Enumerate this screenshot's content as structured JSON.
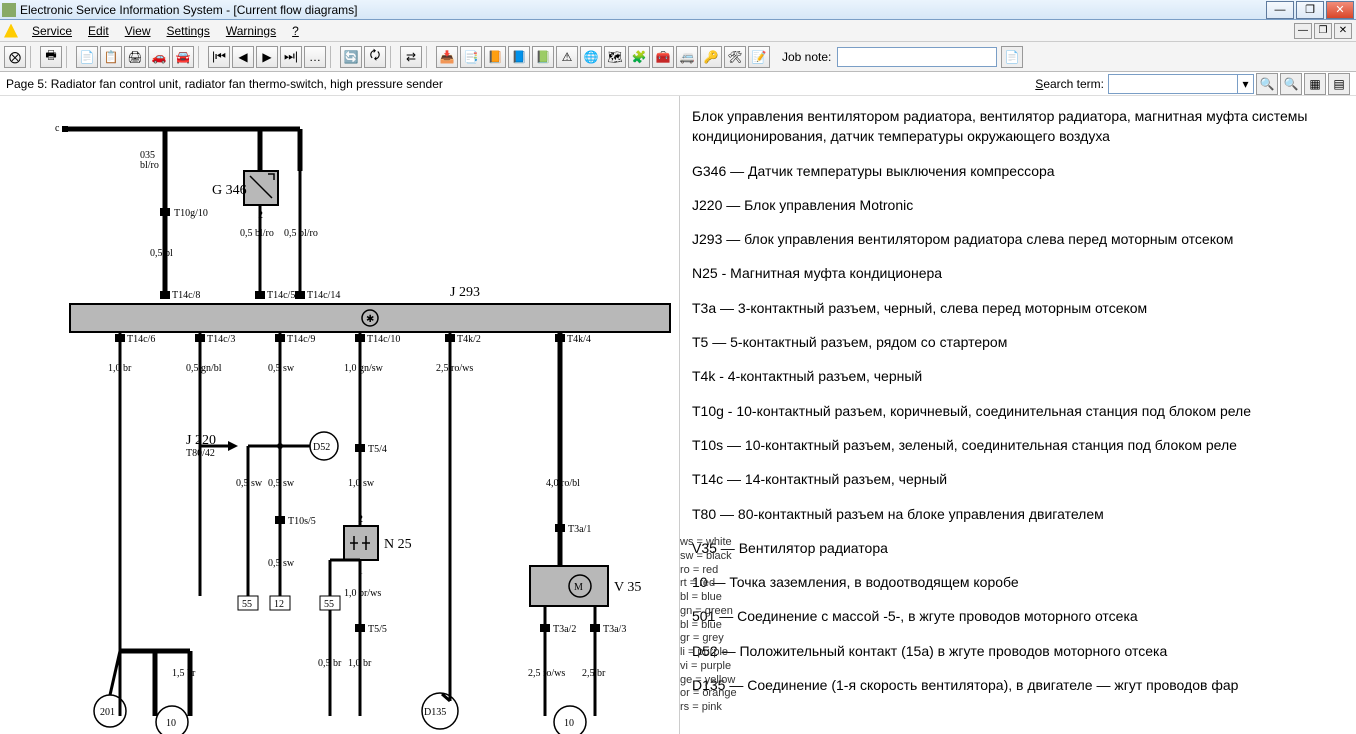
{
  "window": {
    "title": "Electronic Service Information System - [Current flow diagrams]",
    "minimize": "—",
    "maximize": "❐",
    "close": "✕"
  },
  "menu": {
    "items": [
      "Service",
      "Edit",
      "View",
      "Settings",
      "Warnings",
      "?"
    ]
  },
  "toolbar": {
    "icons": [
      "⨂",
      "🖶",
      "📄",
      "📋",
      "🖨",
      "🚗",
      "🚘",
      "|⏮",
      "◀",
      "▶",
      "⏭|",
      "…",
      "🔄",
      "🗘",
      "⇄",
      "📥",
      "📑",
      "📙",
      "📘",
      "📗",
      "⚠",
      "🌐",
      "🗺",
      "🧩",
      "🧰",
      "🚐",
      "🔑",
      "🛠",
      "📝"
    ],
    "jobnote_label": "Job note:",
    "jobnote_value": "",
    "jobnote_btn": "📄"
  },
  "subheader": {
    "title": "Page 5: Radiator fan control unit, radiator fan thermo-switch, high pressure sender",
    "search_label": "Search term:",
    "search_value": ""
  },
  "diagram": {
    "labels": {
      "c": "c",
      "G346": "G 346",
      "J293": "J 293",
      "J220": "J 220",
      "N25": "N 25",
      "V35": "V 35",
      "D52": "D52",
      "D135": "D135",
      "n201": "201",
      "n10a": "10",
      "n10b": "10",
      "n55a": "55",
      "n55b": "55",
      "n12": "12",
      "T10g10": "T10g/10",
      "T14c8": "T14c/8",
      "T14c5": "T14c/5",
      "T14c14": "T14c/14",
      "T14c6": "T14c/6",
      "T14c3": "T14c/3",
      "T14c9": "T14c/9",
      "T14c10": "T14c/10",
      "T4k2": "T4k/2",
      "T4k4": "T4k/4",
      "T80_42": "T80/42",
      "T5_4": "T5/4",
      "T10s5": "T10s/5",
      "T5_5": "T5/5",
      "T3a1": "T3a/1",
      "T3a2": "T3a/2",
      "T3a3": "T3a/3",
      "w035": "035",
      "w_blro": "bl/ro",
      "w05bl": "0,5\nbl",
      "w05blro": "0,5\nbl/ro",
      "w05blro2": "0,5\nbl/ro",
      "w10br": "1,0\nbr",
      "w05gnbl": "0,5\ngn/bl",
      "w05sw": "0,5\nsw",
      "w10gnsw": "1,0\ngn/sw",
      "w25rows": "2,5\nro/ws",
      "w05sw2": "0,5\nsw",
      "w05sw3": "0,5\nsw",
      "w10sw": "1,0\nsw",
      "w40robl": "4,0\nro/bl",
      "w05sw4": "0,5\nsw",
      "w10brws": "1,0\nbr/ws",
      "w05br": "0,5\nbr",
      "w10br2": "1,0\nbr",
      "w15br": "1,5\nbr",
      "w25rows2": "2,5\nro/ws",
      "w25br": "2,5\nbr",
      "pin1": "1",
      "pin2": "2"
    }
  },
  "descriptions": [
    "Блок управления вентилятором радиатора, вентилятор радиатора, магнитная муфта системы кондиционирования, датчик температуры окружающего воздуха",
    "G346 — Датчик температуры выключения компрессора",
    "J220 — Блок управления Motronic",
    "J293 — блок управления вентилятором радиатора слева перед моторным отсеком",
    "N25 - Магнитная муфта кондиционера",
    "T3a — 3-контактный разъем, черный, слева перед моторным отсеком",
    "T5 — 5-контактный разъем, рядом со стартером",
    "T4k - 4-контактный разъем, черный",
    "T10g - 10-контактный разъем, коричневый, соединительная станция под блоком реле",
    "T10s — 10-контактный разъем, зеленый, соединительная станция под блоком реле",
    "T14c — 14-контактный разъем, черный",
    "T80 — 80-контактный разъем на блоке управления двигателем",
    "V35 — Вентилятор радиатора",
    "10 — Точка заземления, в водоотводящем коробе",
    "501 — Соединение с массой -5-, в жгуте проводов моторного отсека",
    "D52 — Положительный контакт (15а) в жгуте проводов моторного отсека",
    "D135 — Соединение (1-я скорость вентилятора), в двигателе — жгут проводов фар"
  ],
  "legend": [
    "ws = white",
    "sw = black",
    "ro = red",
    "rt = red",
    "bl = blue",
    "gn = green",
    "bl = blue",
    "gr = grey",
    "li = purple",
    "vi = purple",
    "ge = yellow",
    "or = orange",
    "rs = pink"
  ]
}
